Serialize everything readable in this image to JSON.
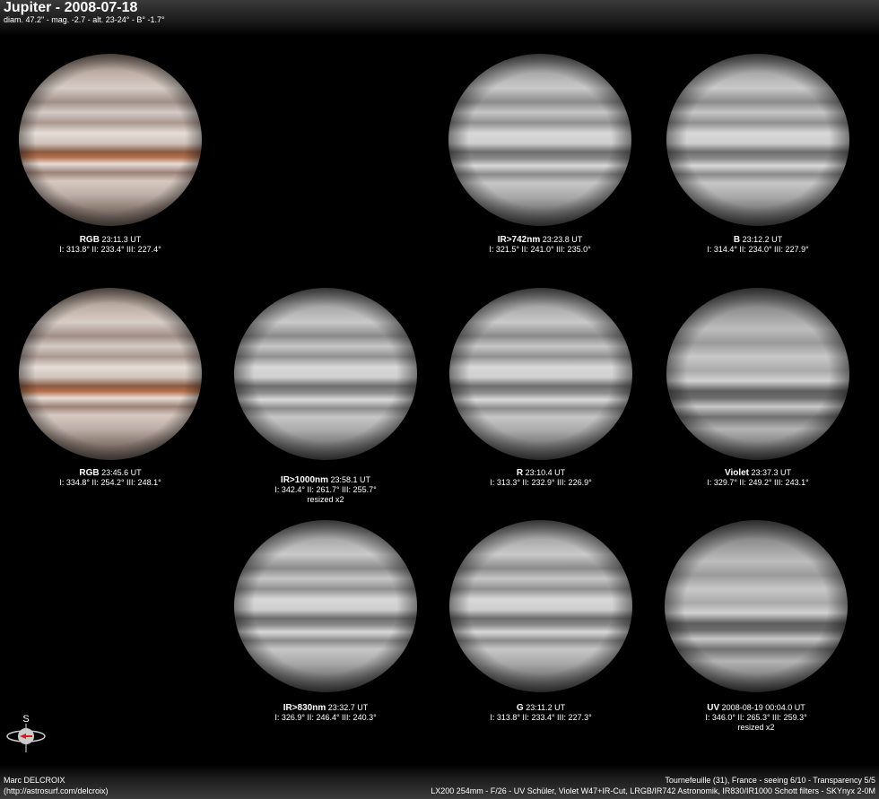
{
  "header": {
    "title": "Jupiter - 2008-07-18",
    "subtitle": "diam. 47.2\" - mag. -2.7 - alt. 23-24° - B° -1.7°"
  },
  "images": [
    {
      "filter": "RGB",
      "time": "23:11.3 UT",
      "longitudes": "I: 313.8° II: 233.4° III: 227.4°",
      "note": ""
    },
    {
      "filter": "IR>742nm",
      "time": "23:23.8 UT",
      "longitudes": "I: 321.5° II: 241.0° III: 235.0°",
      "note": ""
    },
    {
      "filter": "B",
      "time": "23:12.2 UT",
      "longitudes": "I: 314.4° II: 234.0° III: 227.9°",
      "note": ""
    },
    {
      "filter": "RGB",
      "time": "23:45.6 UT",
      "longitudes": "I: 334.8° II: 254.2° III: 248.1°",
      "note": ""
    },
    {
      "filter": "IR>1000nm",
      "time": "23:58.1 UT",
      "longitudes": "I: 342.4° II: 261.7° III: 255.7°",
      "note": "resized x2"
    },
    {
      "filter": "R",
      "time": "23:10.4 UT",
      "longitudes": "I: 313.3° II: 232.9° III: 226.9°",
      "note": ""
    },
    {
      "filter": "Violet",
      "time": "23:37.3 UT",
      "longitudes": "I: 329.7° II: 249.2° III: 243.1°",
      "note": ""
    },
    {
      "filter": "IR>830nm",
      "time": "23:32.7 UT",
      "longitudes": "I: 326.9° II: 246.4° III: 240.3°",
      "note": ""
    },
    {
      "filter": "G",
      "time": "23:11.2 UT",
      "longitudes": "I: 313.8° II: 233.4° III: 227.3°",
      "note": ""
    },
    {
      "filter": "UV",
      "time": "2008-08-19 00:04.0 UT",
      "longitudes": "I: 346.0° II: 265.3° III: 259.3°",
      "note": "resized x2"
    }
  ],
  "compass": {
    "label": "S"
  },
  "footer": {
    "author": "Marc DELCROIX",
    "author_url": "(http://astrosurf.com/delcroix)",
    "site_info": "Tournefeuille (31), France - seeing 6/10 - Transparency 5/5",
    "equipment": "LX200 254mm - F/26 - UV Schüler, Violet W47+IR-Cut, LRGB/IR742 Astronomik, IR830/IR1000 Schott filters - SKYnyx 2-0M"
  }
}
